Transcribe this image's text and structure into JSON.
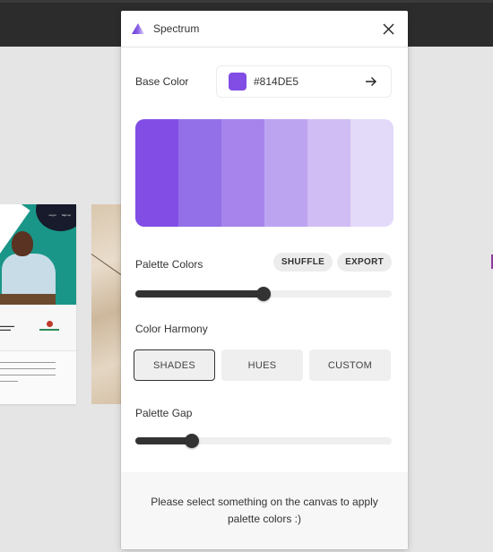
{
  "app": {
    "plugin_title": "Spectrum"
  },
  "base_color": {
    "label": "Base Color",
    "value": "#814DE5",
    "swatch_color": "#814DE5"
  },
  "palette": {
    "swatches": [
      "#814DE5",
      "#9470E8",
      "#A784EC",
      "#BDA4F1",
      "#D0BDF4",
      "#E3DAF9"
    ]
  },
  "palette_colors": {
    "label": "Palette Colors",
    "shuffle_label": "SHUFFLE",
    "export_label": "EXPORT",
    "slider_value_pct": 50
  },
  "color_harmony": {
    "label": "Color Harmony",
    "options": [
      "SHADES",
      "HUES",
      "CUSTOM"
    ],
    "selected": "SHADES"
  },
  "palette_gap": {
    "label": "Palette Gap",
    "slider_value_pct": 22
  },
  "footer": {
    "message": "Please select something on the canvas to apply palette colors :)"
  },
  "canvas": {
    "web_nav_links": [
      "Log in",
      "Sign up"
    ]
  },
  "colors": {
    "topbar": "#2c2c2c",
    "canvas_bg": "#e5e5e5",
    "accent": "#814DE5",
    "slider": "#333333"
  }
}
